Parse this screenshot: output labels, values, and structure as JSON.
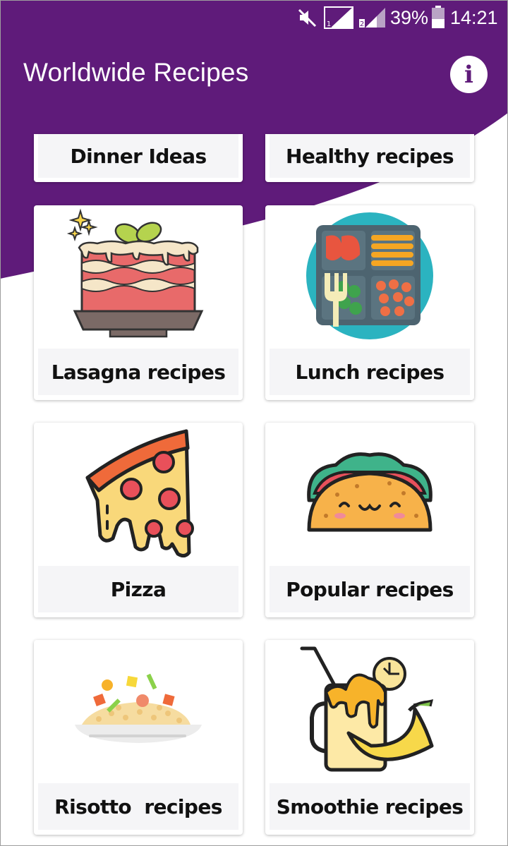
{
  "status_bar": {
    "battery_percent": "39%",
    "time": "14:21",
    "icons": [
      "mute-icon",
      "signal-sim1-icon",
      "signal-sim2-icon",
      "battery-icon"
    ]
  },
  "app_bar": {
    "title": "Worldwide Recipes",
    "info_icon": "info-icon",
    "info_glyph": "i"
  },
  "colors": {
    "primary": "#5f1b7a",
    "card_label_bg": "#f5f5f7",
    "text": "#111111"
  },
  "categories": [
    {
      "label": "Dinner Ideas",
      "icon": "dinner-icon"
    },
    {
      "label": "Healthy recipes",
      "icon": "healthy-icon"
    },
    {
      "label": "Lasagna recipes",
      "icon": "lasagna-icon"
    },
    {
      "label": "Lunch recipes",
      "icon": "lunch-box-icon"
    },
    {
      "label": "Pizza",
      "icon": "pizza-slice-icon"
    },
    {
      "label": "Popular recipes",
      "icon": "taco-icon"
    },
    {
      "label": "Risotto  recipes",
      "icon": "risotto-icon"
    },
    {
      "label": "Smoothie recipes",
      "icon": "smoothie-icon"
    }
  ]
}
